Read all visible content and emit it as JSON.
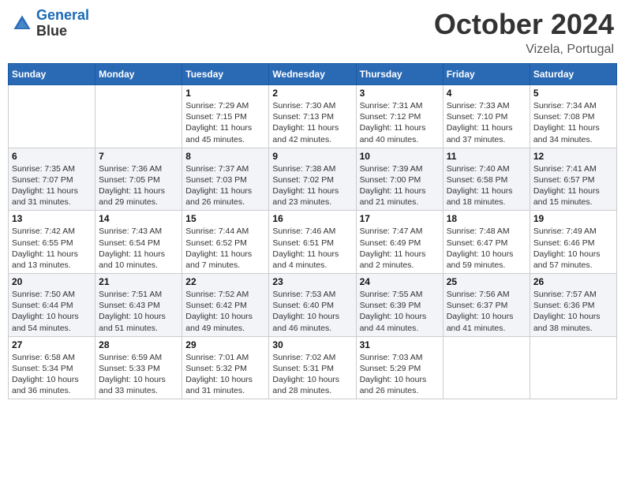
{
  "header": {
    "logo_line1": "General",
    "logo_line2": "Blue",
    "month_title": "October 2024",
    "location": "Vizela, Portugal"
  },
  "days_of_week": [
    "Sunday",
    "Monday",
    "Tuesday",
    "Wednesday",
    "Thursday",
    "Friday",
    "Saturday"
  ],
  "weeks": [
    [
      {
        "day": "",
        "sunrise": "",
        "sunset": "",
        "daylight": ""
      },
      {
        "day": "",
        "sunrise": "",
        "sunset": "",
        "daylight": ""
      },
      {
        "day": "1",
        "sunrise": "Sunrise: 7:29 AM",
        "sunset": "Sunset: 7:15 PM",
        "daylight": "Daylight: 11 hours and 45 minutes."
      },
      {
        "day": "2",
        "sunrise": "Sunrise: 7:30 AM",
        "sunset": "Sunset: 7:13 PM",
        "daylight": "Daylight: 11 hours and 42 minutes."
      },
      {
        "day": "3",
        "sunrise": "Sunrise: 7:31 AM",
        "sunset": "Sunset: 7:12 PM",
        "daylight": "Daylight: 11 hours and 40 minutes."
      },
      {
        "day": "4",
        "sunrise": "Sunrise: 7:33 AM",
        "sunset": "Sunset: 7:10 PM",
        "daylight": "Daylight: 11 hours and 37 minutes."
      },
      {
        "day": "5",
        "sunrise": "Sunrise: 7:34 AM",
        "sunset": "Sunset: 7:08 PM",
        "daylight": "Daylight: 11 hours and 34 minutes."
      }
    ],
    [
      {
        "day": "6",
        "sunrise": "Sunrise: 7:35 AM",
        "sunset": "Sunset: 7:07 PM",
        "daylight": "Daylight: 11 hours and 31 minutes."
      },
      {
        "day": "7",
        "sunrise": "Sunrise: 7:36 AM",
        "sunset": "Sunset: 7:05 PM",
        "daylight": "Daylight: 11 hours and 29 minutes."
      },
      {
        "day": "8",
        "sunrise": "Sunrise: 7:37 AM",
        "sunset": "Sunset: 7:03 PM",
        "daylight": "Daylight: 11 hours and 26 minutes."
      },
      {
        "day": "9",
        "sunrise": "Sunrise: 7:38 AM",
        "sunset": "Sunset: 7:02 PM",
        "daylight": "Daylight: 11 hours and 23 minutes."
      },
      {
        "day": "10",
        "sunrise": "Sunrise: 7:39 AM",
        "sunset": "Sunset: 7:00 PM",
        "daylight": "Daylight: 11 hours and 21 minutes."
      },
      {
        "day": "11",
        "sunrise": "Sunrise: 7:40 AM",
        "sunset": "Sunset: 6:58 PM",
        "daylight": "Daylight: 11 hours and 18 minutes."
      },
      {
        "day": "12",
        "sunrise": "Sunrise: 7:41 AM",
        "sunset": "Sunset: 6:57 PM",
        "daylight": "Daylight: 11 hours and 15 minutes."
      }
    ],
    [
      {
        "day": "13",
        "sunrise": "Sunrise: 7:42 AM",
        "sunset": "Sunset: 6:55 PM",
        "daylight": "Daylight: 11 hours and 13 minutes."
      },
      {
        "day": "14",
        "sunrise": "Sunrise: 7:43 AM",
        "sunset": "Sunset: 6:54 PM",
        "daylight": "Daylight: 11 hours and 10 minutes."
      },
      {
        "day": "15",
        "sunrise": "Sunrise: 7:44 AM",
        "sunset": "Sunset: 6:52 PM",
        "daylight": "Daylight: 11 hours and 7 minutes."
      },
      {
        "day": "16",
        "sunrise": "Sunrise: 7:46 AM",
        "sunset": "Sunset: 6:51 PM",
        "daylight": "Daylight: 11 hours and 4 minutes."
      },
      {
        "day": "17",
        "sunrise": "Sunrise: 7:47 AM",
        "sunset": "Sunset: 6:49 PM",
        "daylight": "Daylight: 11 hours and 2 minutes."
      },
      {
        "day": "18",
        "sunrise": "Sunrise: 7:48 AM",
        "sunset": "Sunset: 6:47 PM",
        "daylight": "Daylight: 10 hours and 59 minutes."
      },
      {
        "day": "19",
        "sunrise": "Sunrise: 7:49 AM",
        "sunset": "Sunset: 6:46 PM",
        "daylight": "Daylight: 10 hours and 57 minutes."
      }
    ],
    [
      {
        "day": "20",
        "sunrise": "Sunrise: 7:50 AM",
        "sunset": "Sunset: 6:44 PM",
        "daylight": "Daylight: 10 hours and 54 minutes."
      },
      {
        "day": "21",
        "sunrise": "Sunrise: 7:51 AM",
        "sunset": "Sunset: 6:43 PM",
        "daylight": "Daylight: 10 hours and 51 minutes."
      },
      {
        "day": "22",
        "sunrise": "Sunrise: 7:52 AM",
        "sunset": "Sunset: 6:42 PM",
        "daylight": "Daylight: 10 hours and 49 minutes."
      },
      {
        "day": "23",
        "sunrise": "Sunrise: 7:53 AM",
        "sunset": "Sunset: 6:40 PM",
        "daylight": "Daylight: 10 hours and 46 minutes."
      },
      {
        "day": "24",
        "sunrise": "Sunrise: 7:55 AM",
        "sunset": "Sunset: 6:39 PM",
        "daylight": "Daylight: 10 hours and 44 minutes."
      },
      {
        "day": "25",
        "sunrise": "Sunrise: 7:56 AM",
        "sunset": "Sunset: 6:37 PM",
        "daylight": "Daylight: 10 hours and 41 minutes."
      },
      {
        "day": "26",
        "sunrise": "Sunrise: 7:57 AM",
        "sunset": "Sunset: 6:36 PM",
        "daylight": "Daylight: 10 hours and 38 minutes."
      }
    ],
    [
      {
        "day": "27",
        "sunrise": "Sunrise: 6:58 AM",
        "sunset": "Sunset: 5:34 PM",
        "daylight": "Daylight: 10 hours and 36 minutes."
      },
      {
        "day": "28",
        "sunrise": "Sunrise: 6:59 AM",
        "sunset": "Sunset: 5:33 PM",
        "daylight": "Daylight: 10 hours and 33 minutes."
      },
      {
        "day": "29",
        "sunrise": "Sunrise: 7:01 AM",
        "sunset": "Sunset: 5:32 PM",
        "daylight": "Daylight: 10 hours and 31 minutes."
      },
      {
        "day": "30",
        "sunrise": "Sunrise: 7:02 AM",
        "sunset": "Sunset: 5:31 PM",
        "daylight": "Daylight: 10 hours and 28 minutes."
      },
      {
        "day": "31",
        "sunrise": "Sunrise: 7:03 AM",
        "sunset": "Sunset: 5:29 PM",
        "daylight": "Daylight: 10 hours and 26 minutes."
      },
      {
        "day": "",
        "sunrise": "",
        "sunset": "",
        "daylight": ""
      },
      {
        "day": "",
        "sunrise": "",
        "sunset": "",
        "daylight": ""
      }
    ]
  ]
}
